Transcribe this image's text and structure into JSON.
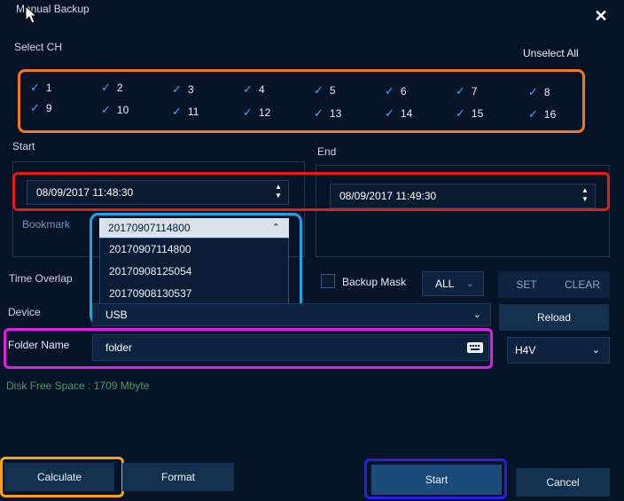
{
  "window": {
    "title": "Manual Backup",
    "close_symbol": "✕"
  },
  "channels": {
    "label": "Select CH",
    "unselect_all": "Unselect All",
    "items": [
      "1",
      "2",
      "3",
      "4",
      "5",
      "6",
      "7",
      "8",
      "9",
      "10",
      "11",
      "12",
      "13",
      "14",
      "15",
      "16"
    ],
    "check_symbol": "✓"
  },
  "time": {
    "start_label": "Start",
    "end_label": "End",
    "start_value": "08/09/2017 11:48:30",
    "end_value": "08/09/2017 11:49:30"
  },
  "bookmark": {
    "label": "Bookmark",
    "selected": "20170907114800",
    "options": [
      "20170907114800",
      "20170908125054",
      "20170908130537"
    ]
  },
  "time_overlap": {
    "label": "Time Overlap"
  },
  "backup_mask": {
    "label": "Backup Mask",
    "value": "ALL",
    "set": "SET",
    "clear": "CLEAR"
  },
  "device": {
    "label": "Device",
    "value": "USB",
    "reload": "Reload"
  },
  "folder": {
    "label": "Folder Name",
    "value": "folder",
    "format_value": "H4V"
  },
  "disk": {
    "free_space": "Disk Free Space : 1709 Mbyte"
  },
  "buttons": {
    "calculate": "Calculate",
    "format": "Format",
    "start": "Start",
    "cancel": "Cancel"
  },
  "colors": {
    "background": "#071427",
    "channel_highlight": "#f07a1e",
    "time_highlight": "#e81b14",
    "bookmark_highlight": "#1aa5e6",
    "folder_highlight": "#e01ee8",
    "calculate_highlight": "#f5a214",
    "start_highlight": "#2c1de6"
  }
}
